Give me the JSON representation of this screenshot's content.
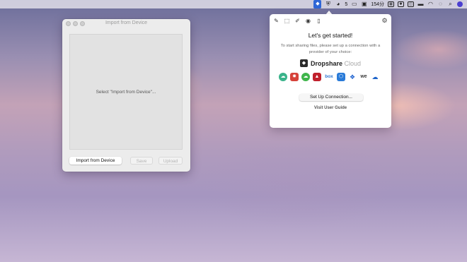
{
  "menubar": {
    "dropshare_icon": "dropshare-icon",
    "wechat_count": "5",
    "time": "154分",
    "icons": [
      "dropshare-icon",
      "shield-icon",
      "wechat-icon",
      "display-icon",
      "camera-icon",
      "grid-icon",
      "app-icon",
      "app2-icon",
      "battery-icon",
      "wifi-icon",
      "chat-icon",
      "search-icon",
      "siri-icon"
    ]
  },
  "import_window": {
    "title": "Import from Device",
    "placeholder": "Select \"Import from Device\"...",
    "import_button": "Import from Device",
    "save_button": "Save",
    "upload_button": "Upload"
  },
  "popover": {
    "title": "Let's get started!",
    "description": "To start sharing files, please set up a connection with a provider of your choice:",
    "brand_name": "Dropshare",
    "brand_suffix": "Cloud",
    "providers": [
      {
        "name": "cloud-app-icon",
        "color": "#39b38a"
      },
      {
        "name": "s3-icon",
        "color": "#d6423a"
      },
      {
        "name": "cloud-green-icon",
        "color": "#3fb54b"
      },
      {
        "name": "red-cloud-icon",
        "color": "#c0202c"
      },
      {
        "name": "box-icon",
        "color": "#2f77d2"
      },
      {
        "name": "nextcloud-icon",
        "color": "#2a7bd8"
      },
      {
        "name": "dropbox-icon",
        "color": "#1e62d0"
      },
      {
        "name": "webdav-icon",
        "color": "#3c3c3c"
      },
      {
        "name": "onedrive-icon",
        "color": "#1d64c9"
      }
    ],
    "setup_button": "Set Up Connection...",
    "guide_link": "Visit User Guide"
  }
}
